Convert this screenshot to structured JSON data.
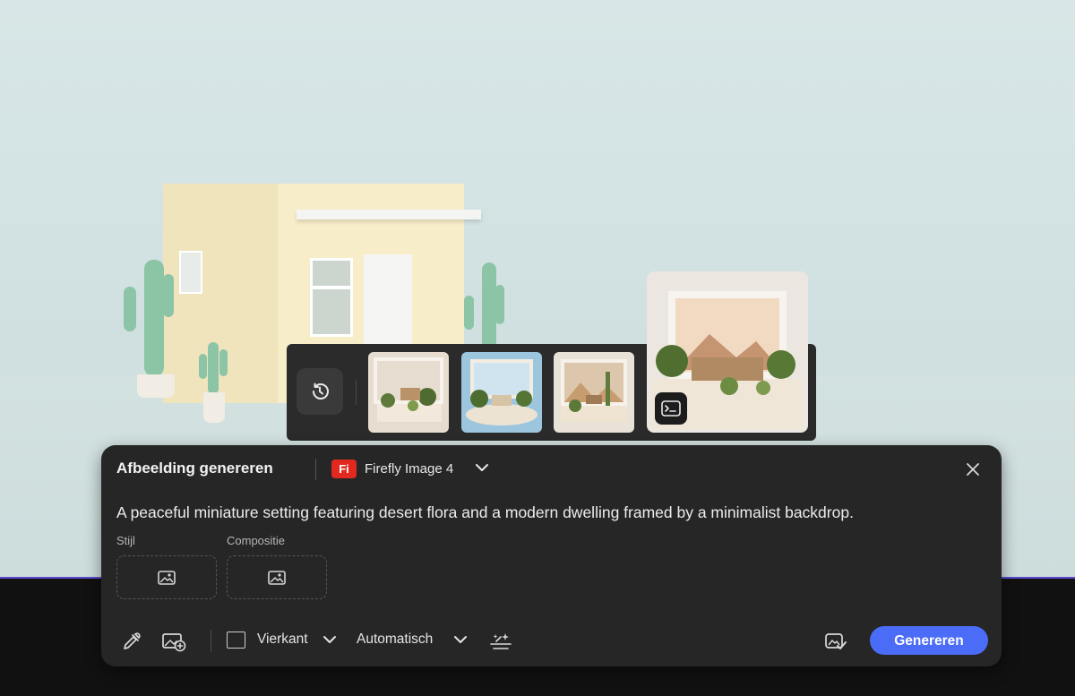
{
  "panel": {
    "title": "Afbeelding genereren",
    "model_badge": "Fi",
    "model_name": "Firefly Image 4",
    "prompt": "A peaceful miniature setting featuring desert flora and a modern dwelling framed by a minimalist backdrop.",
    "style_label": "Stijl",
    "composition_label": "Compositie",
    "aspect_ratio": "Vierkant",
    "content_type": "Automatisch",
    "generate_label": "Genereren"
  },
  "history": {
    "thumbnail_count_visible": 4,
    "selected_index": 3
  },
  "colors": {
    "accent": "#4b6cf7",
    "firefly_badge": "#e1291f",
    "panel_bg": "#262626"
  },
  "icons": [
    "history-icon",
    "close-icon",
    "image-icon",
    "eyedropper-icon",
    "image-add-icon",
    "chevron-down-icon",
    "effects-icon",
    "prompt-icon",
    "content-credentials-icon"
  ]
}
